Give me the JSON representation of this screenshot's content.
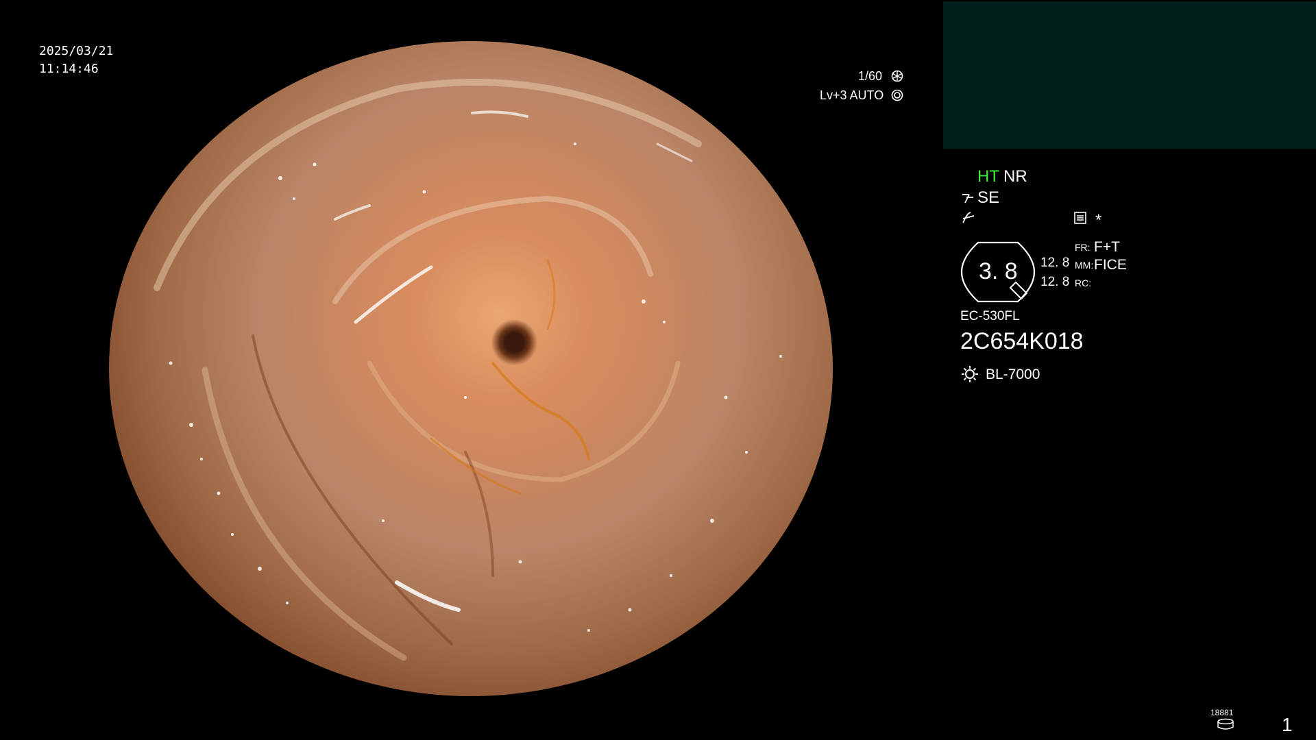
{
  "overlay": {
    "date": "2025/03/21",
    "time": "11:14:46",
    "shutter": "1/60",
    "iris": "Lv+3 AUTO"
  },
  "panel": {
    "ht_label": "HT",
    "nr_label": "NR",
    "se_label": "SE",
    "asterisk": "*",
    "zoom_value": "3. 8",
    "value_top": "12. 8",
    "value_bottom": "12. 8",
    "fr_label": "FR:",
    "fr_value": "F+T",
    "mm_label": "MM:",
    "mm_value": "FICE",
    "rc_label": "RC:",
    "scope_model": "EC-530FL",
    "scope_serial": "2C654K018",
    "light_source": "BL-7000",
    "storage_count": "18881",
    "page_number": "1"
  },
  "colors": {
    "background": "#000000",
    "panel_block": "#01201b",
    "ht_color": "#3df23d",
    "text": "#ffffff"
  },
  "icons": {
    "shutter": "shutter-icon",
    "iris": "iris-icon",
    "structure_enhance": "structure-enhance-icon",
    "gamma": "gamma-curve-icon",
    "memo": "memo-icon",
    "zoom_badge": "zoom-badge-icon",
    "light": "light-source-icon",
    "storage": "storage-disk-icon"
  }
}
